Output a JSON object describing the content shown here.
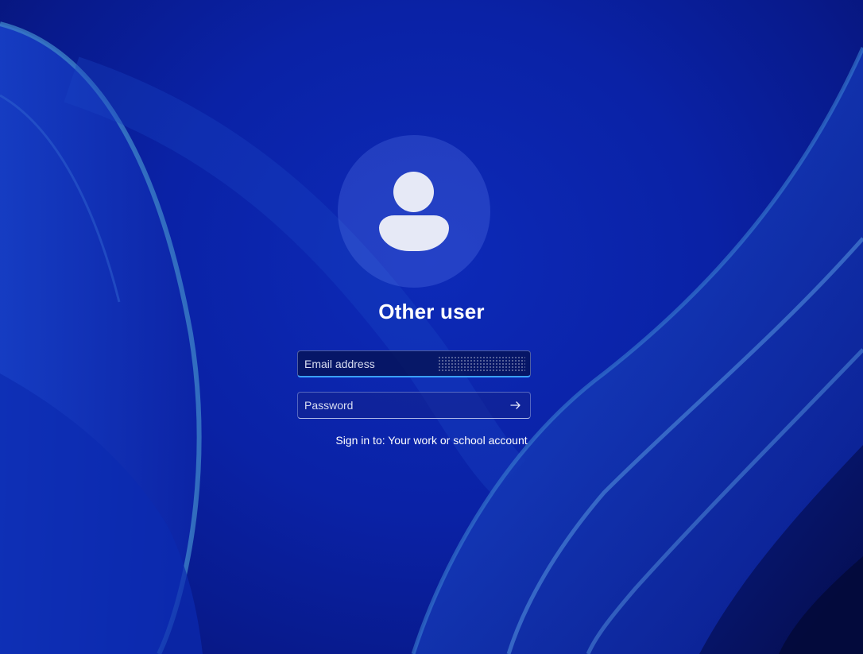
{
  "login": {
    "title": "Other user",
    "email": {
      "placeholder": "Email address",
      "value": ""
    },
    "password": {
      "placeholder": "Password",
      "value": ""
    },
    "sign_in_to": "Sign in to: Your work or school account"
  },
  "icons": {
    "avatar": "person-icon",
    "submit": "arrow-right-icon"
  },
  "colors": {
    "background": "#0a22a6",
    "accent_focus": "#3aa0ff",
    "avatar_fill": "#e6e9f6"
  }
}
